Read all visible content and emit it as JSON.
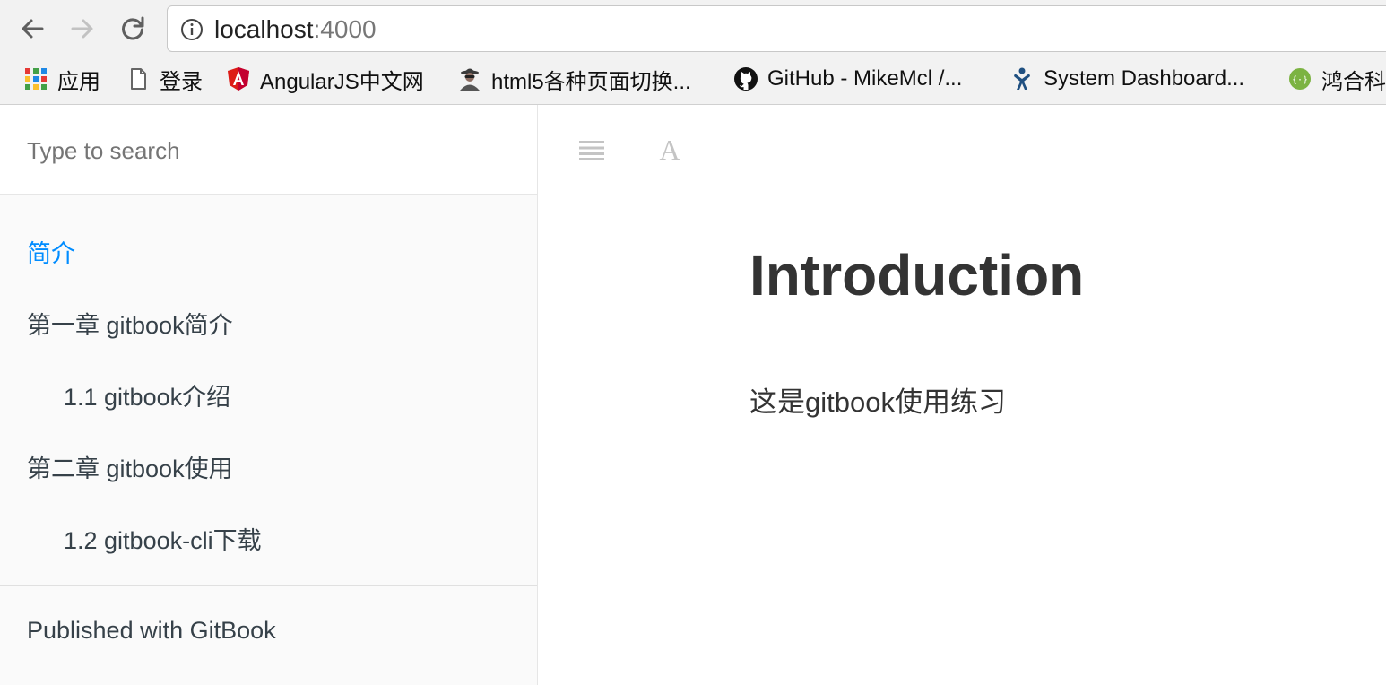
{
  "browser": {
    "url_host": "localhost",
    "url_port": ":4000",
    "bookmarks": [
      {
        "label": "应用",
        "icon": "apps-grid-icon"
      },
      {
        "label": "登录",
        "icon": "page-icon"
      },
      {
        "label": "AngularJS中文网",
        "icon": "angular-shield-icon"
      },
      {
        "label": "html5各种页面切换...",
        "icon": "spy-avatar-icon"
      },
      {
        "label": "GitHub - MikeMcl /...",
        "icon": "github-octocat-icon"
      },
      {
        "label": "System Dashboard...",
        "icon": "jira-icon"
      },
      {
        "label": "鸿合科",
        "icon": "green-circle-icon"
      }
    ]
  },
  "sidebar": {
    "search_placeholder": "Type to search",
    "items": [
      {
        "label": "简介",
        "active": true
      },
      {
        "label": "第一章 gitbook简介"
      },
      {
        "label": "1.1 gitbook介绍"
      },
      {
        "label": "第二章 gitbook使用"
      },
      {
        "label": "1.2 gitbook-cli下载"
      }
    ],
    "published": "Published with GitBook"
  },
  "content": {
    "title": "Introduction",
    "text": "这是gitbook使用练习"
  },
  "colors": {
    "active_link": "#008cff",
    "sidebar_bg": "#fafafa",
    "text": "#333333",
    "chrome_bg": "#f2f2f2"
  }
}
